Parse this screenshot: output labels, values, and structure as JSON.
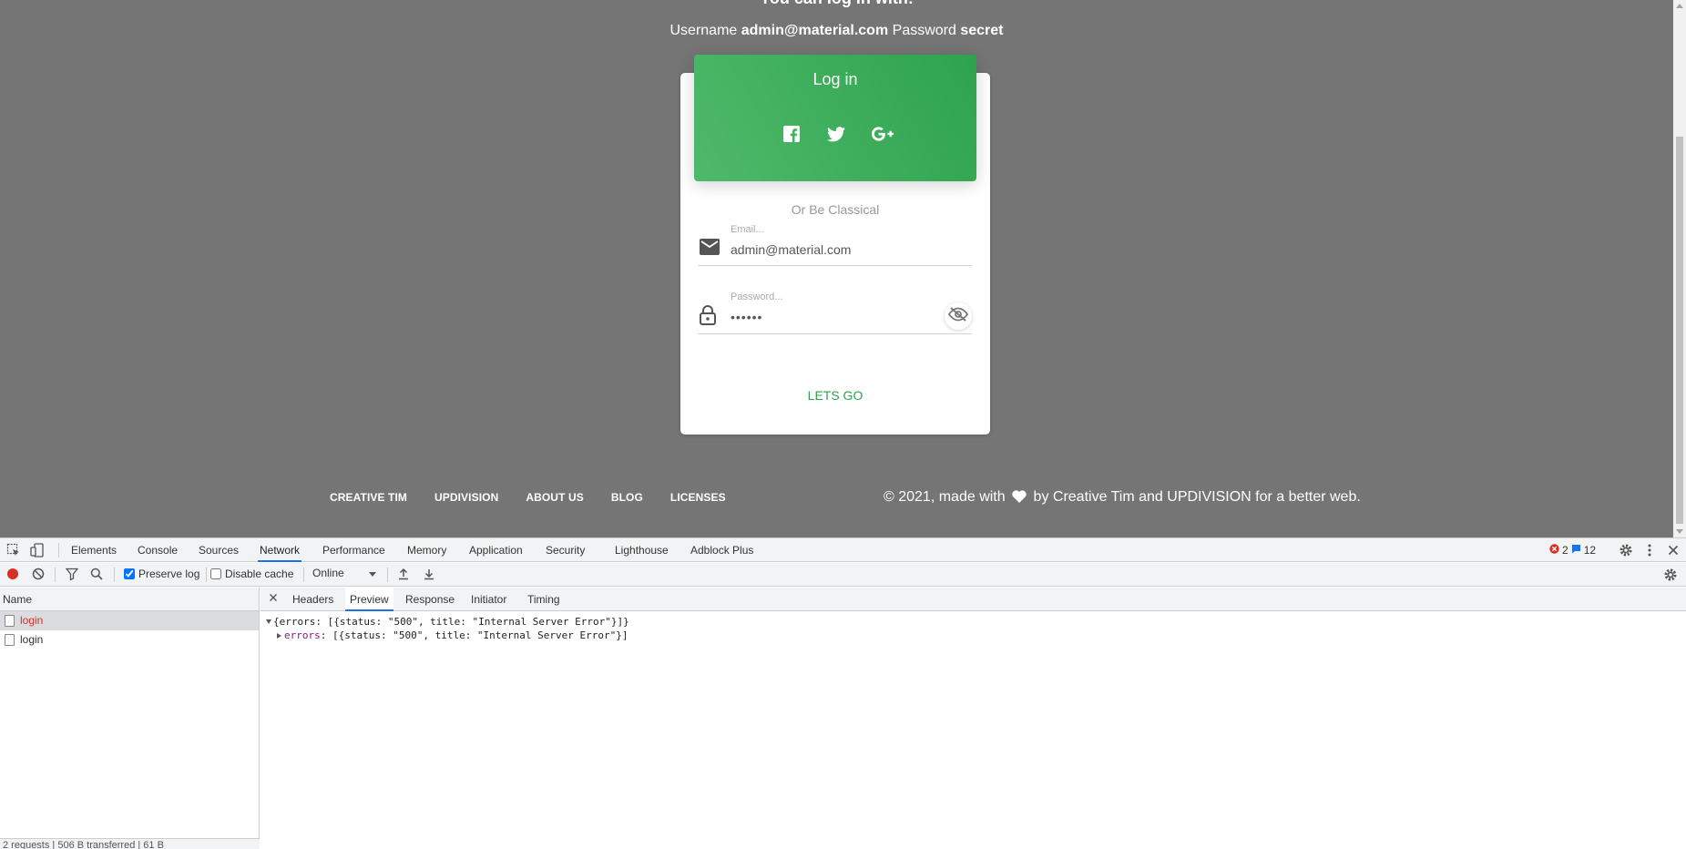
{
  "page": {
    "hint_title": "You can log in with:",
    "hint": {
      "username_label": "Username",
      "username_value": "admin@material.com",
      "password_label": "Password",
      "password_value": "secret"
    },
    "card": {
      "title": "Log in",
      "social_icons": [
        "facebook-icon",
        "twitter-icon",
        "google-plus-icon"
      ],
      "or_text": "Or Be Classical",
      "email": {
        "label": "Email...",
        "value": "admin@material.com",
        "icon": "mail-icon"
      },
      "password": {
        "label": "Password...",
        "value": "••••••",
        "icon": "lock-icon",
        "toggle_icon": "eye-off-icon"
      },
      "submit_label": "LETS GO",
      "accent_color": "#2ea34d"
    },
    "footer": {
      "links": [
        "CREATIVE TIM",
        "UPDIVISION",
        "ABOUT US",
        "BLOG",
        "LICENSES"
      ],
      "copyright_prefix": "© 2021, made with",
      "copyright_suffix": "by Creative Tim and UPDIVISION for a better web."
    }
  },
  "devtools": {
    "tabs": [
      "Elements",
      "Console",
      "Sources",
      "Network",
      "Performance",
      "Memory",
      "Application",
      "Security",
      "Lighthouse",
      "Adblock Plus"
    ],
    "active_tab": "Network",
    "error_count": "2",
    "message_count": "12",
    "toolbar": {
      "preserve_log": "Preserve log",
      "preserve_log_checked": true,
      "disable_cache": "Disable cache",
      "disable_cache_checked": false,
      "throttling": "Online"
    },
    "requests": {
      "header": "Name",
      "rows": [
        {
          "name": "login",
          "status": "error",
          "selected": true
        },
        {
          "name": "login",
          "status": "ok",
          "selected": false
        }
      ],
      "status_bar": "2 requests | 506 B transferred | 61 B"
    },
    "detail": {
      "tabs": [
        "Headers",
        "Preview",
        "Response",
        "Initiator",
        "Timing"
      ],
      "active_tab": "Preview",
      "preview_root": "{errors: [{status: \"500\", title: \"Internal Server Error\"}]}",
      "preview_child_key": "errors",
      "preview_child_value": ": [{status: \"500\", title: \"Internal Server Error\"}]"
    }
  }
}
